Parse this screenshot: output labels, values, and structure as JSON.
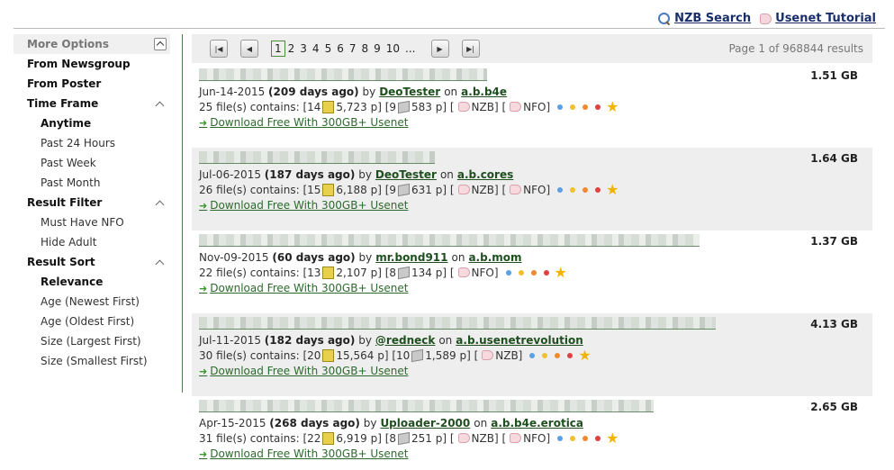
{
  "toplinks": {
    "nzb_search": "NZB Search",
    "usenet_tutorial": "Usenet Tutorial"
  },
  "sidebar": {
    "header": "More Options",
    "from_newsgroup": "From Newsgroup",
    "from_poster": "From Poster",
    "time_frame": {
      "label": "Time Frame",
      "items": [
        "Anytime",
        "Past 24 Hours",
        "Past Week",
        "Past Month"
      ],
      "active": "Anytime"
    },
    "result_filter": {
      "label": "Result Filter",
      "items": [
        "Must Have NFO",
        "Hide Adult"
      ]
    },
    "result_sort": {
      "label": "Result Sort",
      "items": [
        "Relevance",
        "Age (Newest First)",
        "Age (Oldest First)",
        "Size (Largest First)",
        "Size (Smallest First)"
      ],
      "active": "Relevance"
    }
  },
  "pager": {
    "pages": [
      "1",
      "2",
      "3",
      "4",
      "5",
      "6",
      "7",
      "8",
      "9",
      "10",
      "..."
    ],
    "current": "1",
    "page_count_text": "Page 1 of 968844 results"
  },
  "results": [
    {
      "date": "Jun-14-2015",
      "age": "(209 days ago)",
      "by": "by",
      "poster": "DeoTester",
      "on": "on",
      "group": "a.b.b4e",
      "files_prefix": "25 file(s) contains: [14",
      "pages_a": "5,723 p] [9",
      "pages_b": "583 p] [",
      "nzb": "NZB] [",
      "nfo": "NFO]",
      "size": "1.51 GB",
      "download": "Download Free With 300GB+ Usenet"
    },
    {
      "date": "Jul-06-2015",
      "age": "(187 days ago)",
      "by": "by",
      "poster": "DeoTester",
      "on": "on",
      "group": "a.b.cores",
      "files_prefix": "26 file(s) contains: [15",
      "pages_a": "6,188 p] [9",
      "pages_b": "631 p] [",
      "nzb": "NZB] [",
      "nfo": "NFO]",
      "size": "1.64 GB",
      "download": "Download Free With 300GB+ Usenet"
    },
    {
      "date": "Nov-09-2015",
      "age": "(60 days ago)",
      "by": "by",
      "poster": "mr.bond911",
      "on": "on",
      "group": "a.b.mom",
      "files_prefix": "22 file(s) contains: [13",
      "pages_a": "2,107 p] [8",
      "pages_b": "134 p] [",
      "nzb": "NFO]",
      "nfo": "",
      "size": "1.37 GB",
      "download": "Download Free With 300GB+ Usenet"
    },
    {
      "date": "Jul-11-2015",
      "age": "(182 days ago)",
      "by": "by",
      "poster": "@redneck",
      "on": "on",
      "group": "a.b.usenetrevolution",
      "files_prefix": "30 file(s) contains: [20",
      "pages_a": "15,564 p] [10",
      "pages_b": "1,589 p] [",
      "nzb": "NZB]",
      "nfo": "",
      "size": "4.13 GB",
      "download": "Download Free With 300GB+ Usenet"
    },
    {
      "date": "Apr-15-2015",
      "age": "(268 days ago)",
      "by": "by",
      "poster": "Uploader-2000",
      "on": "on",
      "group": "a.b.b4e.erotica",
      "files_prefix": "31 file(s) contains: [22",
      "pages_a": "6,919 p] [8",
      "pages_b": "251 p] [",
      "nzb": "NZB] [",
      "nfo": "NFO]",
      "size": "2.65 GB",
      "download": "Download Free With 300GB+ Usenet"
    }
  ],
  "colors": {
    "link_green": "#1f4f1f",
    "topbar_link": "#1a2e6b",
    "row_alt_bg": "#eeeeee",
    "star": "#f0b400"
  }
}
